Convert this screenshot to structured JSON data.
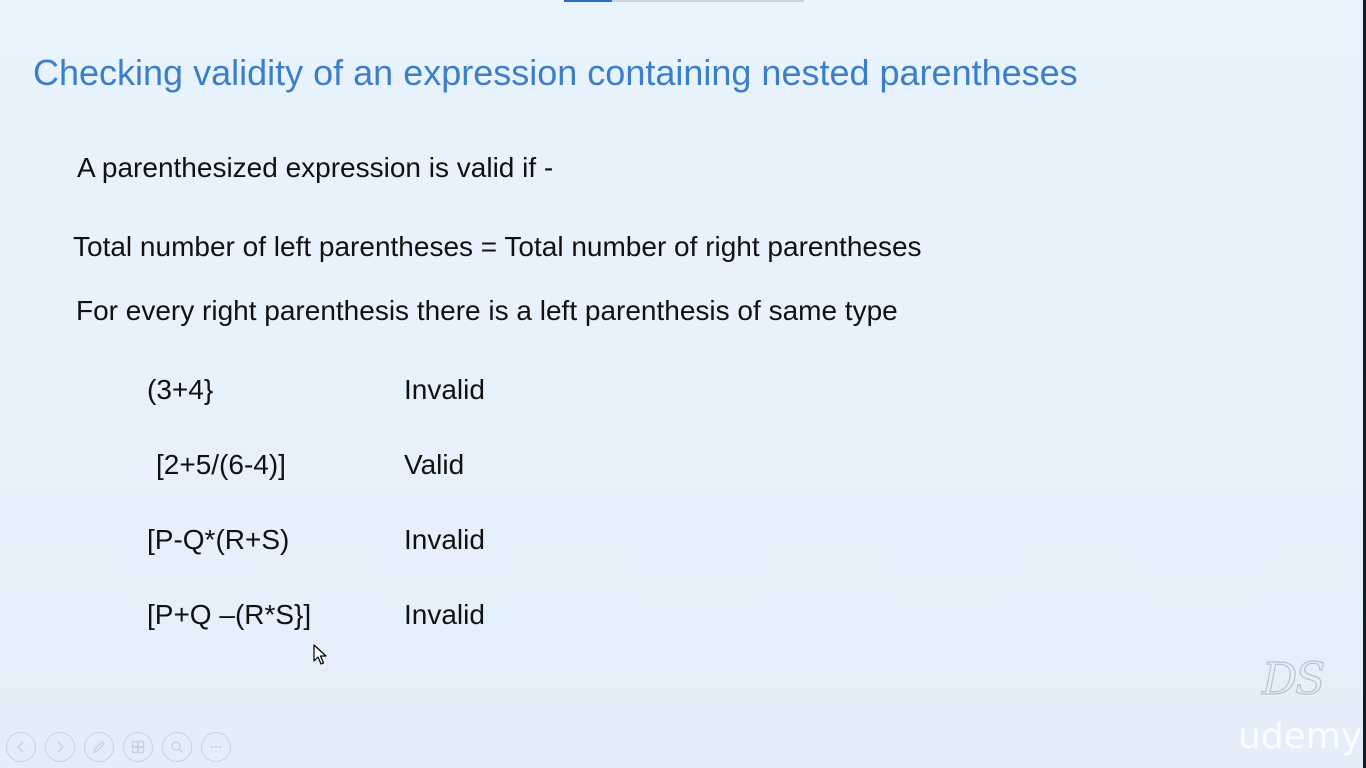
{
  "slide": {
    "title": "Checking validity of an expression containing nested parentheses",
    "intro": "A parenthesized expression is valid if -",
    "rules": [
      "Total number of left parentheses =  Total number of right parentheses",
      "For every right parenthesis there is a left parenthesis of same type"
    ],
    "examples": [
      {
        "expression": "(3+4}",
        "result": "Invalid"
      },
      {
        "expression": "[2+5/(6-4)]",
        "result": "Valid"
      },
      {
        "expression": "[P-Q*(R+S)",
        "result": "Invalid"
      },
      {
        "expression": "[P+Q –(R*S}]",
        "result": "Invalid"
      }
    ]
  },
  "watermark": {
    "logo_text": "DS",
    "brand_text": "udemy"
  },
  "player": {
    "progress_fraction": 0.2,
    "controls": [
      {
        "icon": "previous-icon"
      },
      {
        "icon": "next-icon"
      },
      {
        "icon": "pen-icon"
      },
      {
        "icon": "slides-icon"
      },
      {
        "icon": "zoom-icon"
      },
      {
        "icon": "more-icon"
      }
    ]
  },
  "colors": {
    "title": "#3a7fc8",
    "background": "#e8f2fc",
    "text": "#111111",
    "progress": "#2b6fc4"
  }
}
